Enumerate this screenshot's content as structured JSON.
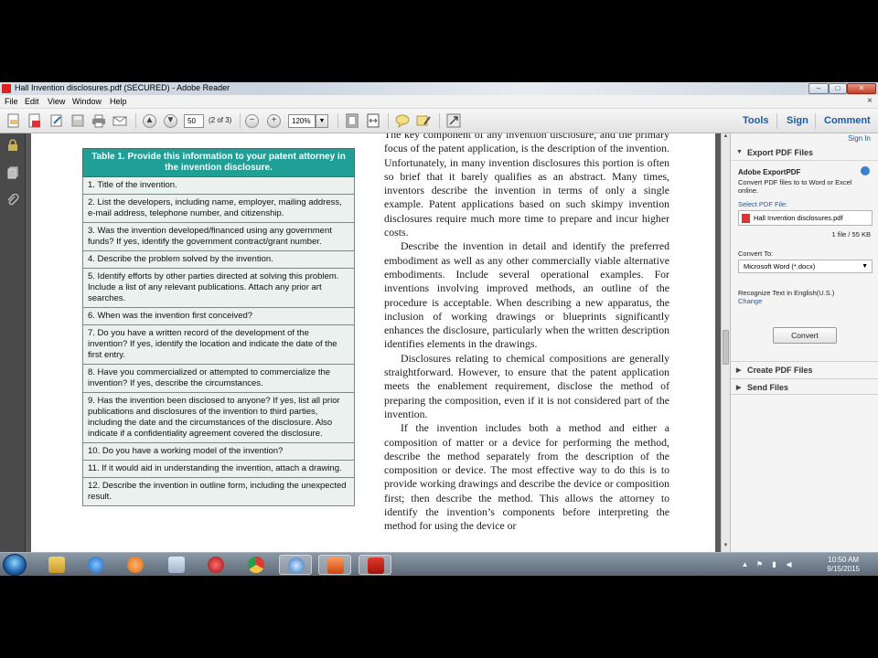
{
  "window": {
    "title": "Hall Invention disclosures.pdf (SECURED) - Adobe Reader",
    "controls": [
      "–",
      "□",
      "✕"
    ]
  },
  "menu": {
    "items": [
      "File",
      "Edit",
      "View",
      "Window",
      "Help"
    ],
    "close_glyph": "×"
  },
  "toolbar": {
    "page_number": "50",
    "page_count": "(2 of 3)",
    "zoom": "120%",
    "right_links": [
      "Tools",
      "Sign",
      "Comment"
    ],
    "icons": [
      "create-pdf-icon",
      "export-pdf-icon",
      "edit-icon",
      "save-icon",
      "print-icon",
      "email-icon",
      "page-up-icon",
      "page-down-icon",
      "zoom-out-icon",
      "zoom-in-icon",
      "fit-page-icon",
      "fit-width-icon",
      "comment-icon",
      "highlight-icon",
      "read-mode-icon"
    ]
  },
  "left_nav": {
    "icons": [
      "lock-icon",
      "pages-icon",
      "attachment-icon"
    ]
  },
  "document": {
    "table_header": "Table 1. Provide this information to your patent attorney in the invention disclosure.",
    "table_rows": [
      "1. Title of the invention.",
      "2. List the developers, including name, employer, mailing address, e-mail address, telephone number, and citizenship.",
      "3. Was the invention developed/financed using any government funds? If yes, identify the government contract/grant number.",
      "4. Describe the problem solved by the invention.",
      "5. Identify efforts by other parties directed at solving this problem. Include a list of any relevant publications. Attach any prior art searches.",
      "6. When was the invention first conceived?",
      "7. Do you have a written record of the development of the invention? If yes, identify the location and indicate the date of the first entry.",
      "8. Have you commercialized or attempted to commercialize the invention? If yes, describe the circumstances.",
      "9. Has the invention been disclosed to anyone? If yes, list all prior publications and disclosures of the invention to third parties, including the date and the circumstances of the disclosure. Also indicate if a confidentiality agreement covered the disclosure.",
      "10. Do you have a working model of the invention?",
      "11. If it would aid in understanding the invention, attach a drawing.",
      "12. Describe the invention in outline form, including the unexpected result."
    ],
    "paragraphs": [
      "The key component of any invention disclosure, and the primary focus of the patent application, is the description of the invention. Unfortunately, in many invention disclosures this portion is often so brief that it barely qualifies as an abstract. Many times, inventors describe the invention in terms of only a single example. Patent applications based on such skimpy invention disclosures require much more time to prepare and incur higher costs.",
      "Describe the invention in detail and identify the preferred embodiment as well as any other commercially viable alternative embodiments. Include several operational examples. For inventions involving improved methods, an outline of the procedure is acceptable. When describing a new apparatus, the inclusion of working drawings or blueprints significantly enhances the disclosure, particularly when the written description identifies elements in the drawings.",
      "Disclosures relating to chemical compositions are generally straightforward. However, to ensure that the patent application meets the enablement requirement, disclose the method of preparing the composition, even if it is not considered part of the invention.",
      "If the invention includes both a method and either a composition of matter or a device for performing the method, describe the method separately from the description of the composition or device. The most effective way to do this is to provide working drawings and describe the device or composition first; then describe the method. This allows the attorney to identify the invention’s components before interpreting the method for using the device or"
    ]
  },
  "right_panel": {
    "sign_in": "Sign In",
    "export_section": "Export PDF Files",
    "product": "Adobe ExportPDF",
    "description": "Convert PDF files to to Word or Excel online.",
    "select_label": "Select PDF File:",
    "file_name": "Hall Invention disclosures.pdf",
    "file_info": "1 file / 55 KB",
    "convert_to_label": "Convert To:",
    "convert_to_value": "Microsoft Word (*.docx)",
    "recognize_text": "Recognize Text in English(U.S.)",
    "change_link": "Change",
    "convert_button": "Convert",
    "create_section": "Create PDF Files",
    "send_section": "Send Files"
  },
  "taskbar": {
    "apps": [
      "file-explorer",
      "internet-explorer",
      "media-player",
      "calculator",
      "game-app",
      "chrome",
      "dell-app",
      "powerpoint",
      "adobe-reader"
    ],
    "time": "10:50 AM",
    "date": "9/15/2015"
  },
  "colors": {
    "table_header": "#1f9f96",
    "table_cell": "#eaf1ef",
    "link_blue": "#1c5aa6",
    "doc_background": "#5a5a5a"
  }
}
